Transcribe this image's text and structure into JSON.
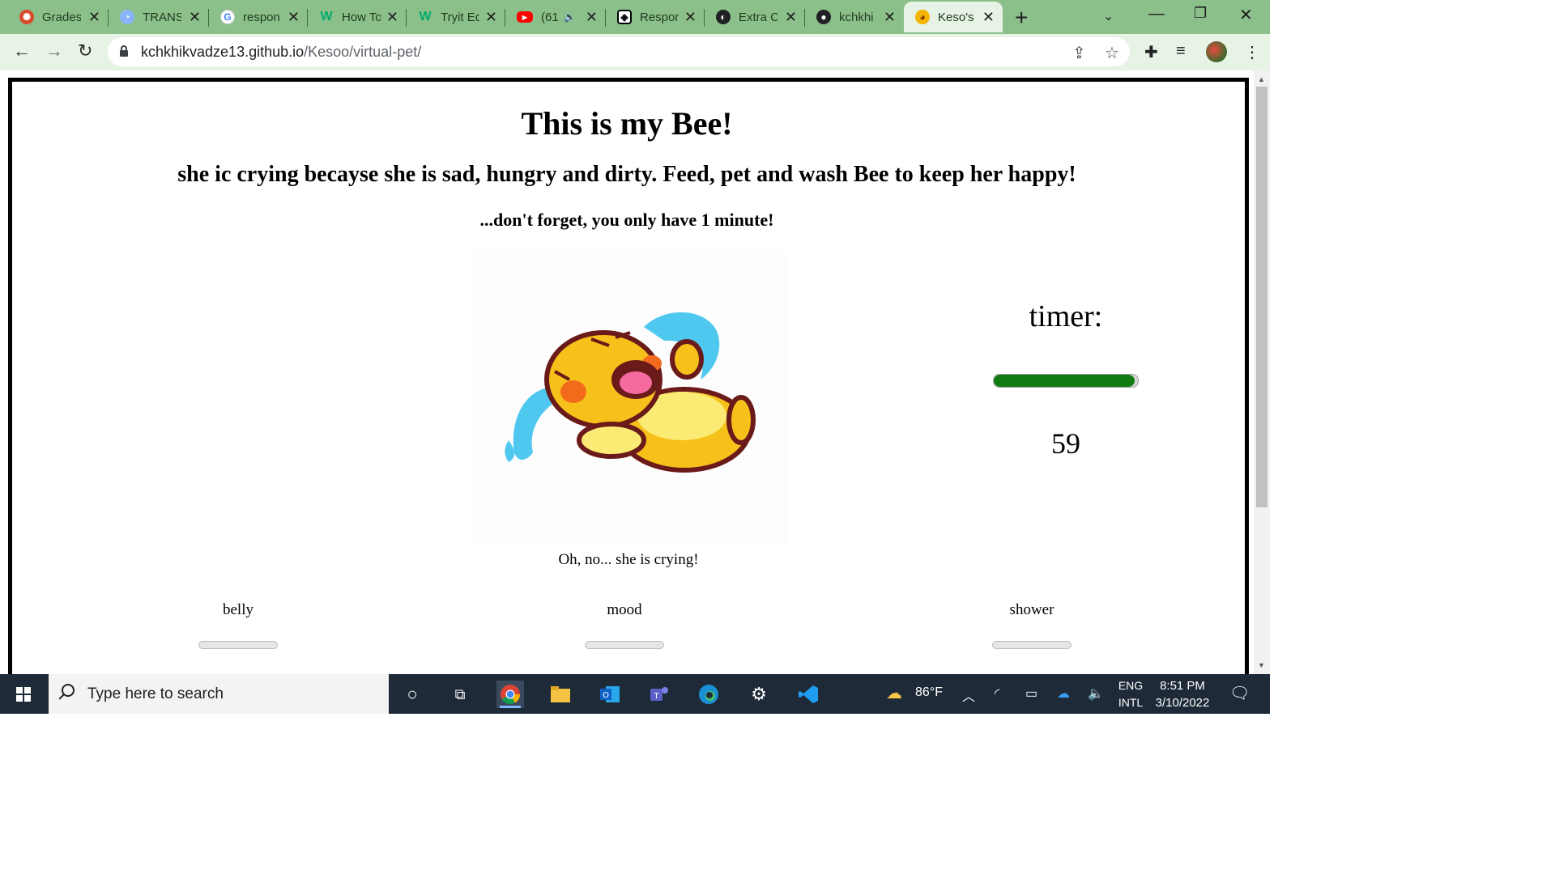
{
  "browser": {
    "tabs": [
      {
        "title": "Grades",
        "favicon": "canvas-icon",
        "color": "#d9482b",
        "active": false
      },
      {
        "title": "TRANS",
        "favicon": "translate-icon",
        "color": "#8ab4f8",
        "active": false
      },
      {
        "title": "respon",
        "favicon": "google-icon",
        "color": "#ffffff",
        "active": false
      },
      {
        "title": "How To",
        "favicon": "w3schools-icon",
        "color": "#04aa6d",
        "active": false
      },
      {
        "title": "Tryit Ed",
        "favicon": "w3schools-icon",
        "color": "#04aa6d",
        "active": false
      },
      {
        "title": "(61",
        "favicon": "youtube-icon",
        "color": "#ff0000",
        "active": false
      },
      {
        "title": "Respon",
        "favicon": "codepen-icon",
        "color": "#ffffff",
        "active": false
      },
      {
        "title": "Extra C",
        "favicon": "globe-icon",
        "color": "#202124",
        "active": false
      },
      {
        "title": "kchkhi",
        "favicon": "github-icon",
        "color": "#202124",
        "active": false
      },
      {
        "title": "Keso's",
        "favicon": "bee-icon",
        "color": "#f5b400",
        "active": true
      }
    ],
    "url_host": "kchkhikvadze13.github.io",
    "url_path": "/Kesoo/virtual-pet/"
  },
  "page": {
    "title": "This is my Bee!",
    "subtitle": "she ic crying becayse she is sad, hungry and dirty. Feed, pet and wash Bee to keep her happy!",
    "warning": "...don't forget, you only have 1 minute!",
    "pet_caption": "Oh, no... she is crying!",
    "timer_label": "timer:",
    "timer_value": "59",
    "timer_progress": 0.98,
    "stats": [
      {
        "label": "belly",
        "level": 0
      },
      {
        "label": "mood",
        "level": 0
      },
      {
        "label": "shower",
        "level": 0
      }
    ]
  },
  "taskbar": {
    "search_placeholder": "Type here to search",
    "weather": "86°F",
    "lang_top": "ENG",
    "lang_bottom": "INTL",
    "time": "8:51 PM",
    "date": "3/10/2022"
  },
  "colors": {
    "tab_strip": "#8cc08a",
    "toolbar": "#e7f3e4",
    "timer_bar": "#137b13",
    "taskbar": "#1e2a38"
  }
}
